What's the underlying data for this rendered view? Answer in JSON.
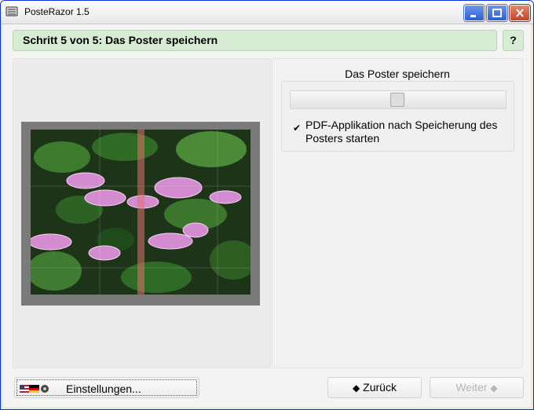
{
  "window": {
    "title": "PosteRazor 1.5",
    "controls": {
      "minimize": "minimize-icon",
      "maximize": "maximize-icon",
      "close": "close-icon"
    }
  },
  "step": {
    "title": "Schritt 5 von 5: Das Poster speichern",
    "help_label": "?"
  },
  "save_panel": {
    "title": "Das Poster speichern",
    "save_button_icon": "save-icon",
    "open_pdf_checkbox": {
      "checked": true,
      "check_glyph": "✔",
      "label": "PDF-Applikation nach Speicherung des Posters starten"
    }
  },
  "footer": {
    "settings_label": "Einstellungen...",
    "back_label": "Zurück",
    "back_icon": "◆",
    "next_label": "Weiter",
    "next_icon": "◆",
    "next_enabled": false
  },
  "colors": {
    "step_header_bg": "#d8ecd5",
    "preview_frame": "#7a7a7a",
    "overlap_band": "#e17070"
  }
}
